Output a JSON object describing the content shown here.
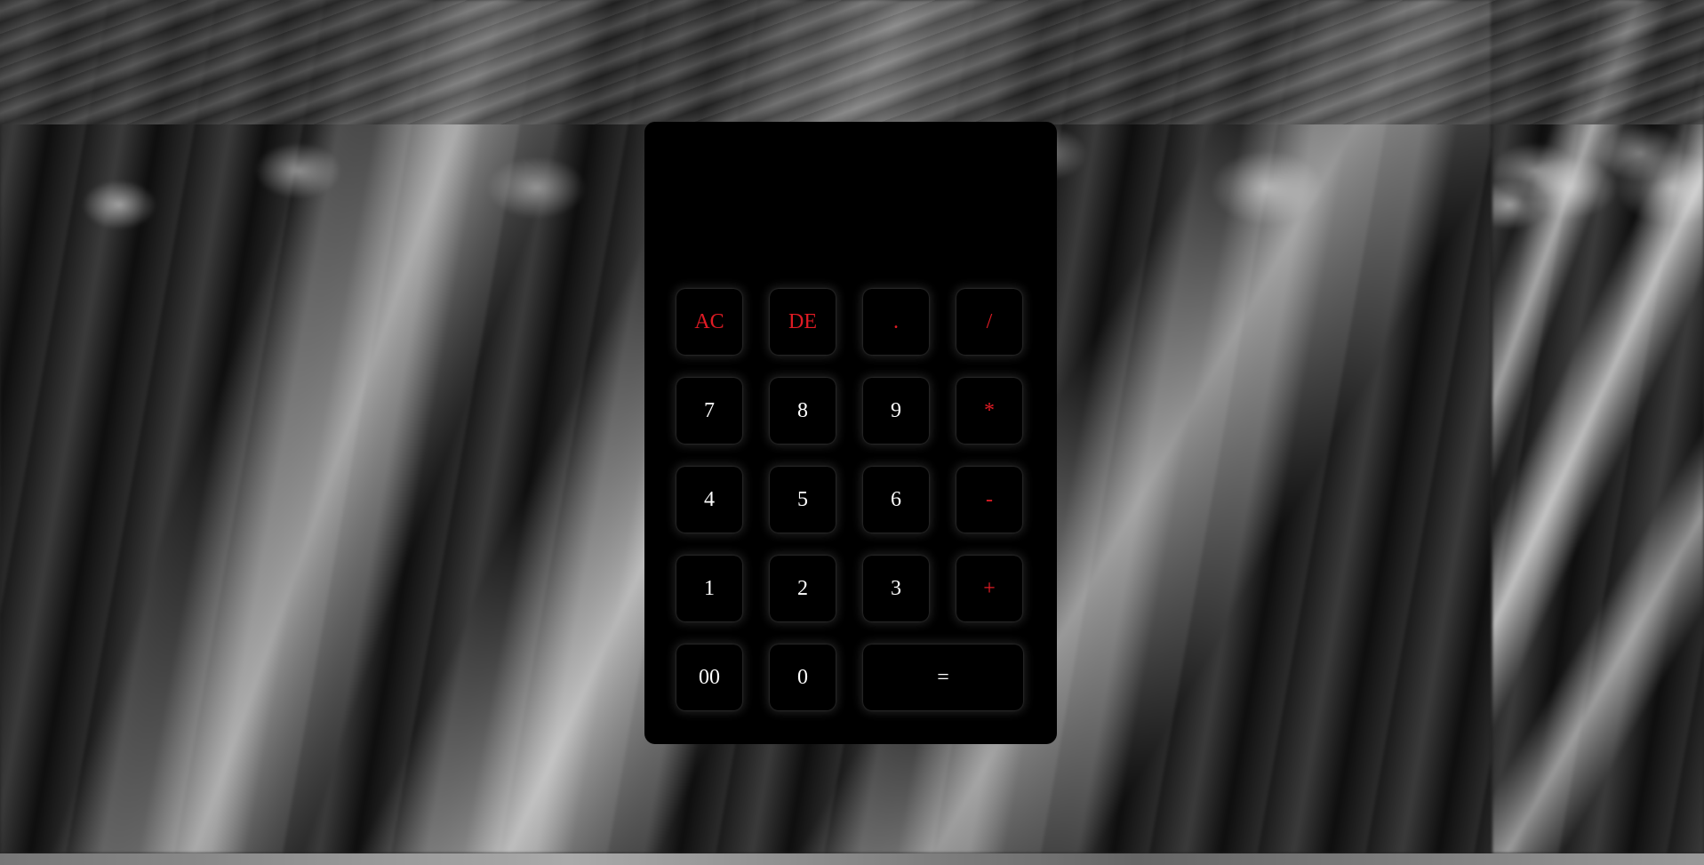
{
  "calculator": {
    "display_value": "",
    "accent_color": "#e01b24",
    "buttons": {
      "ac": "AC",
      "de": "DE",
      "dot": ".",
      "divide": "/",
      "seven": "7",
      "eight": "8",
      "nine": "9",
      "multiply": "*",
      "four": "4",
      "five": "5",
      "six": "6",
      "minus": "-",
      "one": "1",
      "two": "2",
      "three": "3",
      "plus": "+",
      "double_zero": "00",
      "zero": "0",
      "equals": "="
    }
  }
}
